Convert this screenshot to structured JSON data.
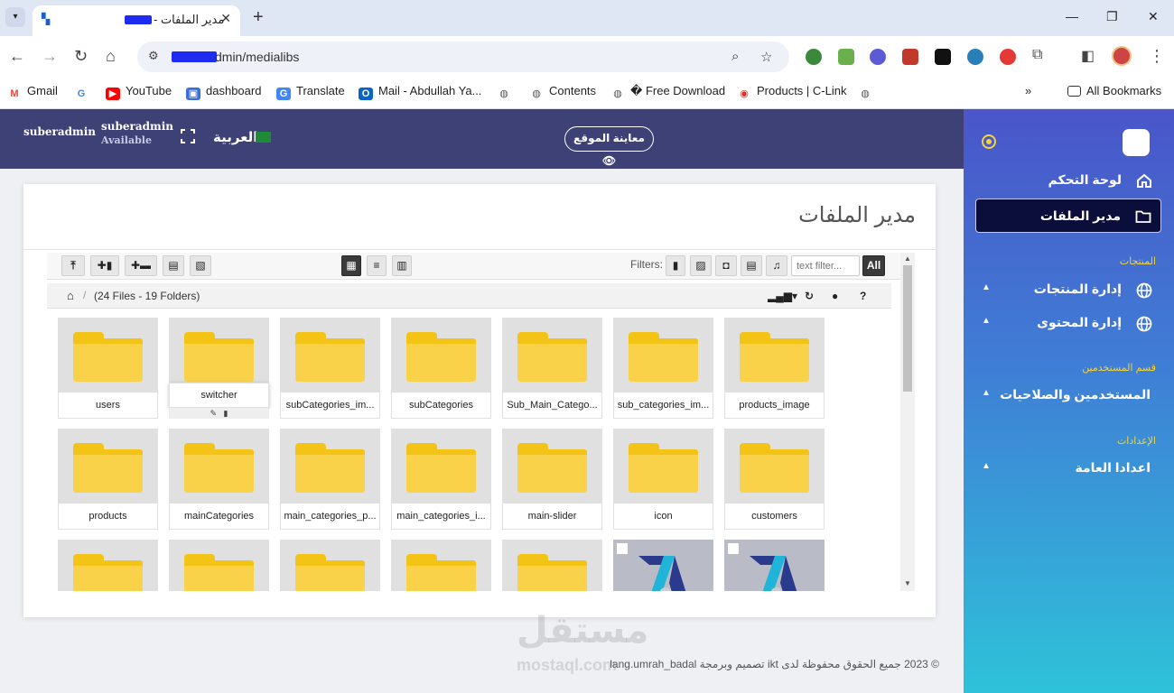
{
  "browser": {
    "tab_title": "مدير الملفات -",
    "url_suffix": "dmin/medialibs",
    "bookmarks": [
      {
        "label": "Gmail",
        "color": "#ea4335"
      },
      {
        "label": "YouTube",
        "color": "#ff0000"
      },
      {
        "label": "dashboard",
        "color": "#3b6fd6"
      },
      {
        "label": "Translate",
        "color": "#4285f4"
      },
      {
        "label": "Mail - Abdullah Ya...",
        "color": "#0a64c8"
      },
      {
        "label": "Contents",
        "color": "#555555"
      },
      {
        "label": "� Free Download",
        "color": "#555555"
      },
      {
        "label": "Products | C-Link",
        "color": "#d93025"
      }
    ],
    "all_bookmarks": "All Bookmarks"
  },
  "header": {
    "user_image_alt": "suberadmin",
    "user_name": "suberadmin",
    "user_status": "Available",
    "language": "العربية",
    "preview_button": "معاينة الموقع"
  },
  "sidebar": {
    "items": [
      {
        "label": "لوحة التحكم",
        "icon": "home-icon"
      },
      {
        "label": "مدير الملفات",
        "icon": "folder-icon",
        "active": true
      }
    ],
    "sections": [
      {
        "title": "المنتجات",
        "items": [
          {
            "label": "إدارة المنتجات",
            "icon": "globe-icon"
          },
          {
            "label": "إدارة المحتوى",
            "icon": "globe-icon"
          }
        ]
      },
      {
        "title": "قسم المستخدمين",
        "items": [
          {
            "label": "المستخدمين والصلاحيات"
          }
        ]
      },
      {
        "title": "الإعدادات",
        "items": [
          {
            "label": "اعدادا العامة"
          }
        ]
      }
    ]
  },
  "page": {
    "title": "مدير الملفات"
  },
  "file_manager": {
    "filters_label": "Filters:",
    "filter_placeholder": "text filter...",
    "filter_all": "All",
    "counts": "(24 Files - 19 Folders)",
    "tiles": [
      {
        "name": "users",
        "type": "folder"
      },
      {
        "name": "switcher",
        "type": "folder",
        "hover": true
      },
      {
        "name": "subCategories_im...",
        "type": "folder"
      },
      {
        "name": "subCategories",
        "type": "folder"
      },
      {
        "name": "Sub_Main_Catego...",
        "type": "folder"
      },
      {
        "name": "sub_categories_im...",
        "type": "folder"
      },
      {
        "name": "products_image",
        "type": "folder"
      },
      {
        "name": "products",
        "type": "folder"
      },
      {
        "name": "mainCategories",
        "type": "folder"
      },
      {
        "name": "main_categories_p...",
        "type": "folder"
      },
      {
        "name": "main_categories_i...",
        "type": "folder"
      },
      {
        "name": "main-slider",
        "type": "folder"
      },
      {
        "name": "icon",
        "type": "folder"
      },
      {
        "name": "customers",
        "type": "folder"
      },
      {
        "name": "",
        "type": "folder"
      },
      {
        "name": "",
        "type": "folder"
      },
      {
        "name": "",
        "type": "folder"
      },
      {
        "name": "",
        "type": "folder"
      },
      {
        "name": "",
        "type": "folder"
      },
      {
        "name": "",
        "type": "image"
      },
      {
        "name": "",
        "type": "image"
      }
    ]
  },
  "footer": {
    "text": "© 2023 جميع الحقوق محفوظة لدى  ikt  تصميم وبرمجة  lang.umrah_badal"
  },
  "watermark": {
    "main": "مستقل",
    "sub": "mostaql.com"
  },
  "colors": {
    "header_bg": "#3e4175",
    "sidebar_top": "#4a55c9",
    "sidebar_bottom": "#2ec2d9",
    "accent_yellow": "#f4d33b",
    "folder_yellow": "#f9d24a"
  }
}
